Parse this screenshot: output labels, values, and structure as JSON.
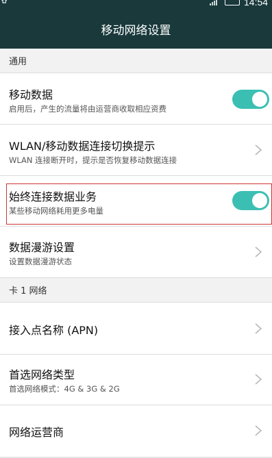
{
  "status_bar": {
    "time": "14:54"
  },
  "title": "移动网络设置",
  "sections": {
    "general": "通用",
    "sim1": "卡 1 网络"
  },
  "rows": [
    {
      "title": "移动数据",
      "subtitle": "启用后，产生的流量将由运营商收取相应资费",
      "control": "toggle",
      "on": true
    },
    {
      "title": "WLAN/移动数据连接切换提示",
      "subtitle": "WLAN 连接断开时，提示是否恢复移动数据连接",
      "control": "chevron"
    },
    {
      "title": "始终连接数据业务",
      "subtitle": "某些移动网络耗用更多电量",
      "control": "toggle",
      "on": true
    },
    {
      "title": "数据漫游设置",
      "subtitle": "设置数据漫游状态",
      "control": "chevron"
    },
    {
      "title": "接入点名称 (APN)",
      "control": "chevron"
    },
    {
      "title": "首选网络类型",
      "subtitle": "首选网络模式：4G & 3G & 2G",
      "control": "chevron"
    },
    {
      "title": "网络运营商",
      "control": "chevron"
    }
  ],
  "colors": {
    "header": "#19393b",
    "accent": "#3bbfb3",
    "highlight": "#cc3333"
  }
}
